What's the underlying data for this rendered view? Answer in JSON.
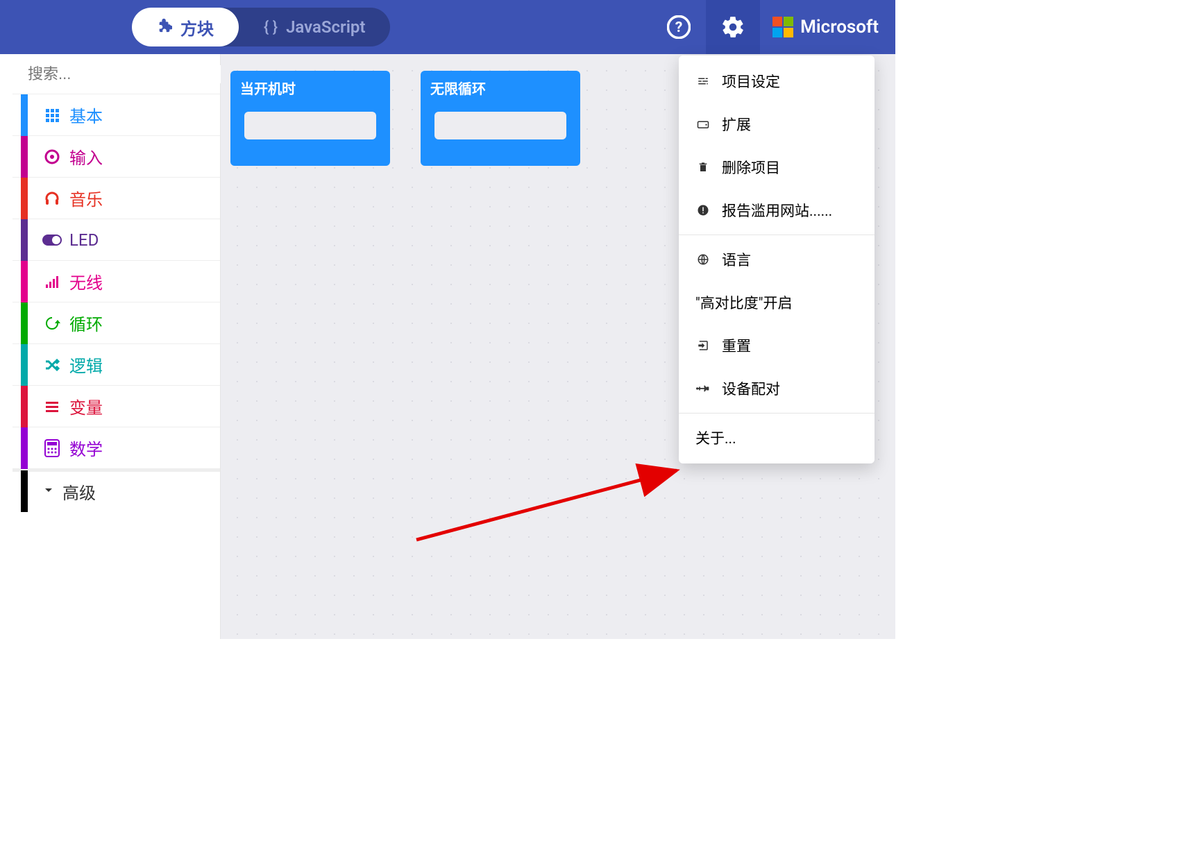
{
  "header": {
    "tabs": {
      "blocks": "方块",
      "js": "JavaScript"
    },
    "microsoft": "Microsoft"
  },
  "search": {
    "placeholder": "搜索..."
  },
  "categories": [
    {
      "label": "基本",
      "color": "#1E90FF",
      "icon": "grid"
    },
    {
      "label": "输入",
      "color": "#C2008F",
      "icon": "target"
    },
    {
      "label": "音乐",
      "color": "#E63022",
      "icon": "headphones"
    },
    {
      "label": "LED",
      "color": "#5C2D91",
      "icon": "toggle"
    },
    {
      "label": "无线",
      "color": "#E3008C",
      "icon": "signal"
    },
    {
      "label": "循环",
      "color": "#00AA00",
      "icon": "refresh"
    },
    {
      "label": "逻辑",
      "color": "#00A9A9",
      "icon": "shuffle"
    },
    {
      "label": "变量",
      "color": "#DC143C",
      "icon": "list"
    },
    {
      "label": "数学",
      "color": "#9400D3",
      "icon": "calc"
    }
  ],
  "advanced": {
    "label": "高级"
  },
  "workspace": {
    "block1": "当开机时",
    "block2": "无限循环"
  },
  "menu": {
    "project_settings": "项目设定",
    "extensions": "扩展",
    "delete_project": "删除项目",
    "report_abuse": "报告滥用网站......",
    "language": "语言",
    "high_contrast": "\"高对比度\"开启",
    "reset": "重置",
    "pair_device": "设备配对",
    "about": "关于..."
  }
}
